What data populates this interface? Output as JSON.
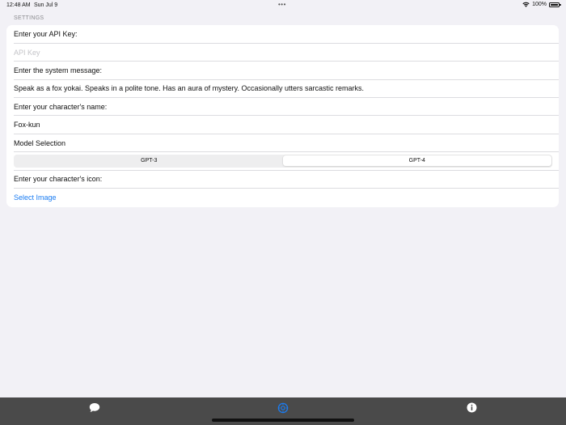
{
  "status_bar": {
    "time": "12:48 AM",
    "date": "Sun Jul 9",
    "dots": "•••",
    "battery_percent": "100%"
  },
  "settings": {
    "section_title": "SETTINGS",
    "api_key_label": "Enter your API Key:",
    "api_key_placeholder": "API Key",
    "api_key_value": "",
    "system_message_label": "Enter the system message:",
    "system_message_value": "Speak as a fox yokai. Speaks in a polite tone. Has an aura of mystery. Occasionally utters sarcastic remarks.",
    "character_name_label": "Enter your character's name:",
    "character_name_value": "Fox-kun",
    "model_selection_label": "Model Selection",
    "model_options": [
      "GPT-3",
      "GPT-4"
    ],
    "selected_model": "GPT-4",
    "character_icon_label": "Enter your character's icon:",
    "select_image_label": "Select Image"
  },
  "tab_bar": {
    "tabs": [
      {
        "icon": "chat-bubble-icon",
        "active": false
      },
      {
        "icon": "gear-icon",
        "active": true
      },
      {
        "icon": "info-icon",
        "active": false
      }
    ],
    "active_color": "#1a7cf2",
    "inactive_color": "#ffffff",
    "background": "#4a4a4a"
  },
  "colors": {
    "background": "#f2f1f6",
    "link": "#1a7cf2",
    "placeholder": "#c3c3c7",
    "section_header": "#8a8a8e"
  }
}
